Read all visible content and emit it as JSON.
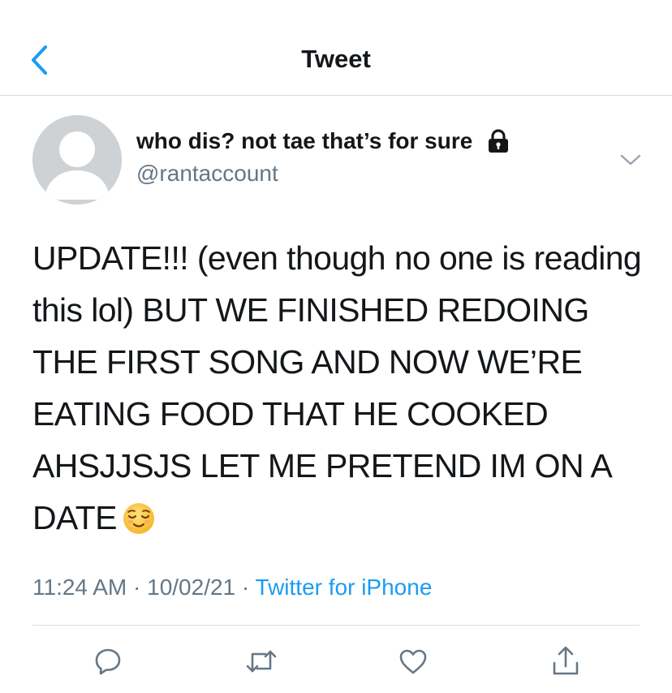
{
  "header": {
    "title": "Tweet",
    "back_icon": "chevron-left-icon"
  },
  "tweet": {
    "display_name": "who dis? not tae that’s for sure",
    "handle": "@rantaccount",
    "protected_icon": "lock-icon",
    "text": "UPDATE!!! (even though no one is reading this lol) BUT WE FINISHED REDOING THE FIRST SONG AND NOW WE’RE EATING FOOD THAT HE COOKED AHSJJSJS LET ME PRETEND IM ON A DATE",
    "emoji": "relieved-face-emoji",
    "time": "11:24 AM",
    "date": "10/02/21",
    "separator": "·",
    "source": "Twitter for iPhone"
  },
  "actions": [
    "reply-icon",
    "retweet-icon",
    "like-icon",
    "share-icon"
  ],
  "colors": {
    "accent": "#1d9bf0",
    "secondary_text": "#657786",
    "avatar_bg": "#cfd2d4"
  }
}
